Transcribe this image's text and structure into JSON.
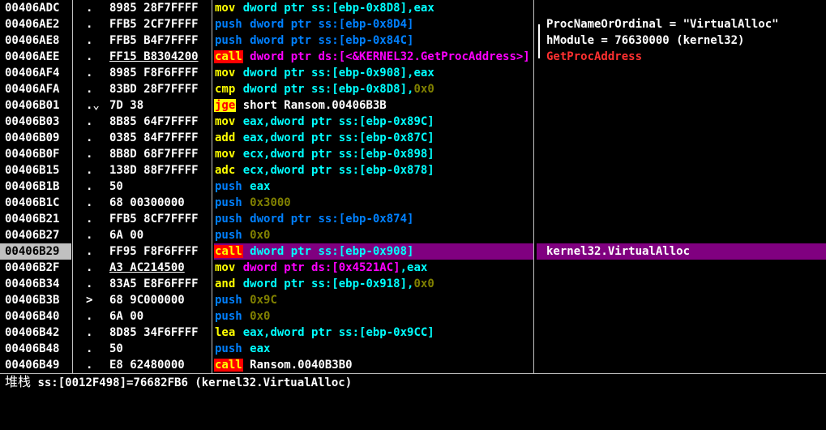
{
  "rows": [
    {
      "addr": "00406ADC",
      "flow": ".",
      "hex": "8985 28F7FFFF",
      "mn": "mov",
      "mclass": "m-mov",
      "ops": [
        [
          "dword ptr ss:[ebp-0x8D8]",
          "op-dw"
        ],
        [
          ",eax",
          "op-reg"
        ]
      ],
      "cmt": "",
      "cmtc": ""
    },
    {
      "addr": "00406AE2",
      "flow": ".",
      "hex": "FFB5 2CF7FFFF",
      "mn": "push",
      "mclass": "m-push",
      "ops": [
        [
          "dword ptr ss:[ebp-0x8D4]",
          "op-dw"
        ]
      ],
      "cmt": "ProcNameOrOrdinal = \"VirtualAlloc\"",
      "cmtc": "t-cmt-plain"
    },
    {
      "addr": "00406AE8",
      "flow": ".",
      "hex": "FFB5 B4F7FFFF",
      "mn": "push",
      "mclass": "m-push",
      "ops": [
        [
          "dword ptr ss:[ebp-0x84C]",
          "op-dw"
        ]
      ],
      "cmt": "hModule = 76630000 (kernel32)",
      "cmtc": "t-cmt-plain"
    },
    {
      "addr": "00406AEE",
      "flow": ".",
      "hex": "FF15 B8304200",
      "mn": "call",
      "mclass": "m-call",
      "ops": [
        [
          "dword ptr ds:[<&KERNEL32.GetProcAddress>]",
          "op-api"
        ]
      ],
      "cmt": "GetProcAddress",
      "cmtc": "t-cmt-red"
    },
    {
      "addr": "00406AF4",
      "flow": ".",
      "hex": "8985 F8F6FFFF",
      "mn": "mov",
      "mclass": "m-mov",
      "ops": [
        [
          "dword ptr ss:[ebp-0x908]",
          "op-dw"
        ],
        [
          ",eax",
          "op-reg"
        ]
      ],
      "cmt": "",
      "cmtc": ""
    },
    {
      "addr": "00406AFA",
      "flow": ".",
      "hex": "83BD 28F7FFFF",
      "mn": "cmp",
      "mclass": "m-cmp",
      "ops": [
        [
          "dword ptr ss:[ebp-0x8D8]",
          "op-dw"
        ],
        [
          ",",
          "op-dw"
        ],
        [
          "0x0",
          "op-num"
        ]
      ],
      "cmt": "",
      "cmtc": ""
    },
    {
      "addr": "00406B01",
      "flow": ".⌄",
      "hex": "7D 38",
      "mn": "jge",
      "mclass": "m-jge",
      "ops": [
        [
          "short Ransom.00406B3B",
          "op-tgt"
        ]
      ],
      "cmt": "",
      "cmtc": ""
    },
    {
      "addr": "00406B03",
      "flow": ".",
      "hex": "8B85 64F7FFFF",
      "mn": "mov",
      "mclass": "m-mov",
      "ops": [
        [
          "eax,dword ptr ss:[ebp-0x89C]",
          "op-dw"
        ]
      ],
      "cmt": "",
      "cmtc": ""
    },
    {
      "addr": "00406B09",
      "flow": ".",
      "hex": "0385 84F7FFFF",
      "mn": "add",
      "mclass": "m-add",
      "ops": [
        [
          "eax,dword ptr ss:[ebp-0x87C]",
          "op-dw"
        ]
      ],
      "cmt": "",
      "cmtc": ""
    },
    {
      "addr": "00406B0F",
      "flow": ".",
      "hex": "8B8D 68F7FFFF",
      "mn": "mov",
      "mclass": "m-mov",
      "ops": [
        [
          "ecx,dword ptr ss:[ebp-0x898]",
          "op-dw"
        ]
      ],
      "cmt": "",
      "cmtc": ""
    },
    {
      "addr": "00406B15",
      "flow": ".",
      "hex": "138D 88F7FFFF",
      "mn": "adc",
      "mclass": "m-adc",
      "ops": [
        [
          "ecx,dword ptr ss:[ebp-0x878]",
          "op-dw"
        ]
      ],
      "cmt": "",
      "cmtc": ""
    },
    {
      "addr": "00406B1B",
      "flow": ".",
      "hex": "50",
      "mn": "push",
      "mclass": "m-push",
      "ops": [
        [
          "eax",
          "op-reg"
        ]
      ],
      "cmt": "",
      "cmtc": ""
    },
    {
      "addr": "00406B1C",
      "flow": ".",
      "hex": "68 00300000",
      "mn": "push",
      "mclass": "m-push",
      "ops": [
        [
          "0x3000",
          "op-num"
        ]
      ],
      "cmt": "",
      "cmtc": ""
    },
    {
      "addr": "00406B21",
      "flow": ".",
      "hex": "FFB5 8CF7FFFF",
      "mn": "push",
      "mclass": "m-push",
      "ops": [
        [
          "dword ptr ss:[ebp-0x874]",
          "op-dw"
        ]
      ],
      "cmt": "",
      "cmtc": ""
    },
    {
      "addr": "00406B27",
      "flow": ".",
      "hex": "6A 00",
      "mn": "push",
      "mclass": "m-push",
      "ops": [
        [
          "0x0",
          "op-num"
        ]
      ],
      "cmt": "",
      "cmtc": ""
    },
    {
      "addr": "00406B29",
      "flow": ".",
      "hex": "FF95 F8F6FFFF",
      "mn": "call",
      "mclass": "m-call",
      "ops": [
        [
          "dword ptr ss:[ebp-0x908]",
          "op-dw"
        ]
      ],
      "cmt": "kernel32.VirtualAlloc",
      "cmtc": "t-cmt-plain",
      "selected": true
    },
    {
      "addr": "00406B2F",
      "flow": ".",
      "hex": "A3 AC214500",
      "mn": "mov",
      "mclass": "m-mov",
      "ops": [
        [
          "dword ptr ds:[0x4521AC]",
          "op-api"
        ],
        [
          ",eax",
          "op-reg"
        ]
      ],
      "cmt": "",
      "cmtc": ""
    },
    {
      "addr": "00406B34",
      "flow": ".",
      "hex": "83A5 E8F6FFFF",
      "mn": "and",
      "mclass": "m-and",
      "ops": [
        [
          "dword ptr ss:[ebp-0x918]",
          "op-dw"
        ],
        [
          ",",
          "op-dw"
        ],
        [
          "0x0",
          "op-num"
        ]
      ],
      "cmt": "",
      "cmtc": ""
    },
    {
      "addr": "00406B3B",
      "flow": ">",
      "hex": "68 9C000000",
      "mn": "push",
      "mclass": "m-push",
      "ops": [
        [
          "0x9C",
          "op-num"
        ]
      ],
      "cmt": "",
      "cmtc": ""
    },
    {
      "addr": "00406B40",
      "flow": ".",
      "hex": "6A 00",
      "mn": "push",
      "mclass": "m-push",
      "ops": [
        [
          "0x0",
          "op-num"
        ]
      ],
      "cmt": "",
      "cmtc": ""
    },
    {
      "addr": "00406B42",
      "flow": ".",
      "hex": "8D85 34F6FFFF",
      "mn": "lea",
      "mclass": "m-lea",
      "ops": [
        [
          "eax,dword ptr ss:[ebp-0x9CC]",
          "op-dw"
        ]
      ],
      "cmt": "",
      "cmtc": ""
    },
    {
      "addr": "00406B48",
      "flow": ".",
      "hex": "50",
      "mn": "push",
      "mclass": "m-push",
      "ops": [
        [
          "eax",
          "op-reg"
        ]
      ],
      "cmt": "",
      "cmtc": ""
    },
    {
      "addr": "00406B49",
      "flow": ".",
      "hex": "E8 62480000",
      "mn": "call",
      "mclass": "m-call",
      "ops": [
        [
          "Ransom.0040B3B0",
          "op-tgt"
        ]
      ],
      "cmt": "",
      "cmtc": ""
    }
  ],
  "status": {
    "label": "堆栈",
    "text": " ss:[0012F498]=76682FB6 (kernel32.VirtualAlloc)"
  },
  "colors": {
    "background": "#000000",
    "selection": "#800080",
    "call_bg": "#ff0000",
    "jump_bg": "#ffff00",
    "register": "#00ffff",
    "constant": "#808000",
    "push": "#0080ff",
    "api": "#ff00ff"
  }
}
